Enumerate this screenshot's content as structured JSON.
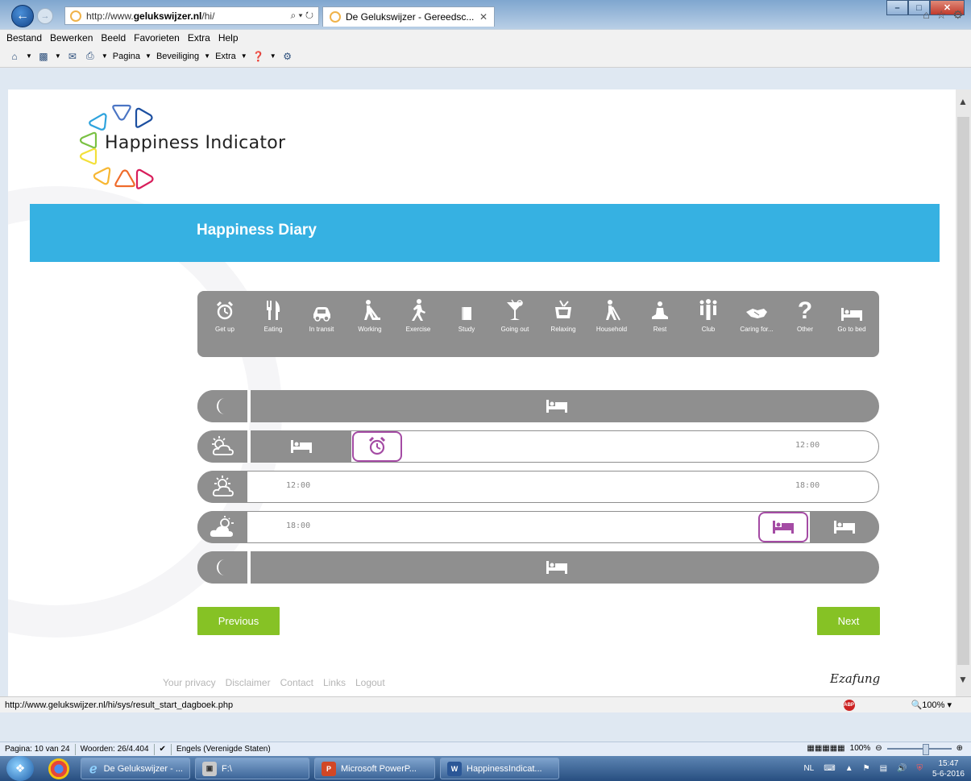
{
  "browser": {
    "address_prefix": "http://www.",
    "address_domain": "gelukswijzer.nl",
    "address_path": "/hi/",
    "address_controls": "⌕ ▾ ↻",
    "tab_title": "De Gelukswijzer - Gereedsc...",
    "tab_close": "✕",
    "win_min": "–",
    "win_max": "□",
    "win_close": "✕",
    "menu": [
      "Bestand",
      "Bewerken",
      "Beeld",
      "Favorieten",
      "Extra",
      "Help"
    ],
    "commands": {
      "page": "Pagina",
      "security": "Beveiliging",
      "extra": "Extra"
    }
  },
  "site": {
    "logo_text": "Happiness Indicator",
    "banner_title": "Happiness Diary",
    "activities": [
      {
        "label": "Get up",
        "icon": "alarm-clock-icon"
      },
      {
        "label": "Eating",
        "icon": "fork-knife-icon"
      },
      {
        "label": "In transit",
        "icon": "car-icon"
      },
      {
        "label": "Working",
        "icon": "worker-icon"
      },
      {
        "label": "Exercise",
        "icon": "running-icon"
      },
      {
        "label": "Study",
        "icon": "book-icon"
      },
      {
        "label": "Going out",
        "icon": "cocktail-icon"
      },
      {
        "label": "Relaxing",
        "icon": "tv-icon"
      },
      {
        "label": "Household",
        "icon": "vacuum-icon"
      },
      {
        "label": "Rest",
        "icon": "meditation-icon"
      },
      {
        "label": "Club",
        "icon": "group-icon"
      },
      {
        "label": "Caring for...",
        "icon": "handshake-icon"
      },
      {
        "label": "Other",
        "icon": "question-icon"
      },
      {
        "label": "Go to bed",
        "icon": "bed-icon"
      }
    ],
    "timeline": {
      "row2_end": "12:00",
      "row3_start": "12:00",
      "row3_end": "18:00",
      "row4_start": "18:00"
    },
    "previous_label": "Previous",
    "next_label": "Next",
    "footer_links": [
      "Your privacy",
      "Disclaimer",
      "Contact",
      "Links",
      "Logout"
    ],
    "erasmus_sig": "Ezafung"
  },
  "status": {
    "url": "http://www.gelukswijzer.nl/hi/sys/result_start_dagboek.php",
    "abp": "ABP",
    "zoom": "🔍100% ▾"
  },
  "word_status": {
    "page": "Pagina: 10 van 24",
    "words": "Woorden: 26/4.404",
    "language": "Engels (Verenigde Staten)",
    "zoom": "100%"
  },
  "taskbar": {
    "ie_label": "De Gelukswijzer - ...",
    "explorer_label": "F:\\",
    "ppt_label": "Microsoft PowerP...",
    "word_label": "HappinessIndicat...",
    "lang": "NL",
    "time": "15:47",
    "date": "5-6-2016"
  }
}
